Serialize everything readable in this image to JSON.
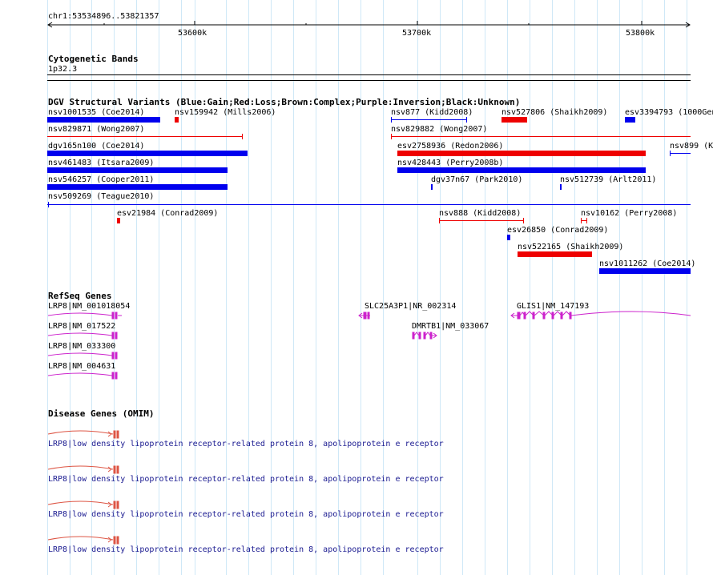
{
  "colors": {
    "gain": "#0000ee",
    "loss": "#ee0000",
    "refseq": "#cc22cc",
    "omim": "#dd5544",
    "omim_label": "#1a1a90",
    "grid": "#cfe8f7"
  },
  "ruler": {
    "region": "chr1:53534896..53821357",
    "ticks": [
      {
        "label": "53600k"
      },
      {
        "label": "53700k"
      },
      {
        "label": "53800k"
      }
    ]
  },
  "cyto": {
    "title": "Cytogenetic Bands",
    "band": "1p32.3"
  },
  "dgv": {
    "title": "DGV Structural Variants (Blue:Gain;Red:Loss;Brown:Complex;Purple:Inversion;Black:Unknown)",
    "variants": [
      {
        "label": "nsv1001535 (Coe2014)",
        "type": "gain",
        "style": "bar"
      },
      {
        "label": "nsv159942 (Mills2006)",
        "type": "loss",
        "style": "bar"
      },
      {
        "label": "nsv877 (Kidd2008)",
        "type": "gain",
        "style": "line"
      },
      {
        "label": "nsv527806 (Shaikh2009)",
        "type": "loss",
        "style": "bar"
      },
      {
        "label": "esv3394793 (1000Gen",
        "type": "gain",
        "style": "bar"
      },
      {
        "label": "nsv829871 (Wong2007)",
        "type": "loss",
        "style": "line"
      },
      {
        "label": "nsv829882 (Wong2007)",
        "type": "loss",
        "style": "line"
      },
      {
        "label": "dgv165n100 (Coe2014)",
        "type": "gain",
        "style": "bar"
      },
      {
        "label": "esv2758936 (Redon2006)",
        "type": "loss",
        "style": "bar"
      },
      {
        "label": "nsv899 (K",
        "type": "gain",
        "style": "line"
      },
      {
        "label": "nsv461483 (Itsara2009)",
        "type": "gain",
        "style": "bar"
      },
      {
        "label": "nsv428443 (Perry2008b)",
        "type": "gain",
        "style": "bar"
      },
      {
        "label": "nsv546257 (Cooper2011)",
        "type": "gain",
        "style": "bar"
      },
      {
        "label": "dgv37n67 (Park2010)",
        "type": "gain",
        "style": "bar"
      },
      {
        "label": "nsv512739 (Arlt2011)",
        "type": "gain",
        "style": "bar"
      },
      {
        "label": "nsv509269 (Teague2010)",
        "type": "gain",
        "style": "line"
      },
      {
        "label": "esv21984 (Conrad2009)",
        "type": "loss",
        "style": "bar"
      },
      {
        "label": "nsv888 (Kidd2008)",
        "type": "loss",
        "style": "line"
      },
      {
        "label": "nsv10162 (Perry2008)",
        "type": "loss",
        "style": "line"
      },
      {
        "label": "esv26850 (Conrad2009)",
        "type": "gain",
        "style": "bar"
      },
      {
        "label": "nsv522165 (Shaikh2009)",
        "type": "loss",
        "style": "bar"
      },
      {
        "label": "nsv1011262 (Coe2014)",
        "type": "gain",
        "style": "bar"
      }
    ]
  },
  "refseq": {
    "title": "RefSeq Genes",
    "genes": [
      {
        "label": "LRP8|NM_001018054"
      },
      {
        "label": "LRP8|NM_017522"
      },
      {
        "label": "LRP8|NM_033300"
      },
      {
        "label": "LRP8|NM_004631"
      },
      {
        "label": "SLC25A3P1|NR_002314"
      },
      {
        "label": "DMRTB1|NM_033067"
      },
      {
        "label": "GLIS1|NM_147193"
      }
    ]
  },
  "omim": {
    "title": "Disease Genes (OMIM)",
    "entries": [
      {
        "label": "LRP8|low density lipoprotein receptor-related protein 8, apolipoprotein e receptor"
      },
      {
        "label": "LRP8|low density lipoprotein receptor-related protein 8, apolipoprotein e receptor"
      },
      {
        "label": "LRP8|low density lipoprotein receptor-related protein 8, apolipoprotein e receptor"
      },
      {
        "label": "LRP8|low density lipoprotein receptor-related protein 8, apolipoprotein e receptor"
      }
    ]
  }
}
